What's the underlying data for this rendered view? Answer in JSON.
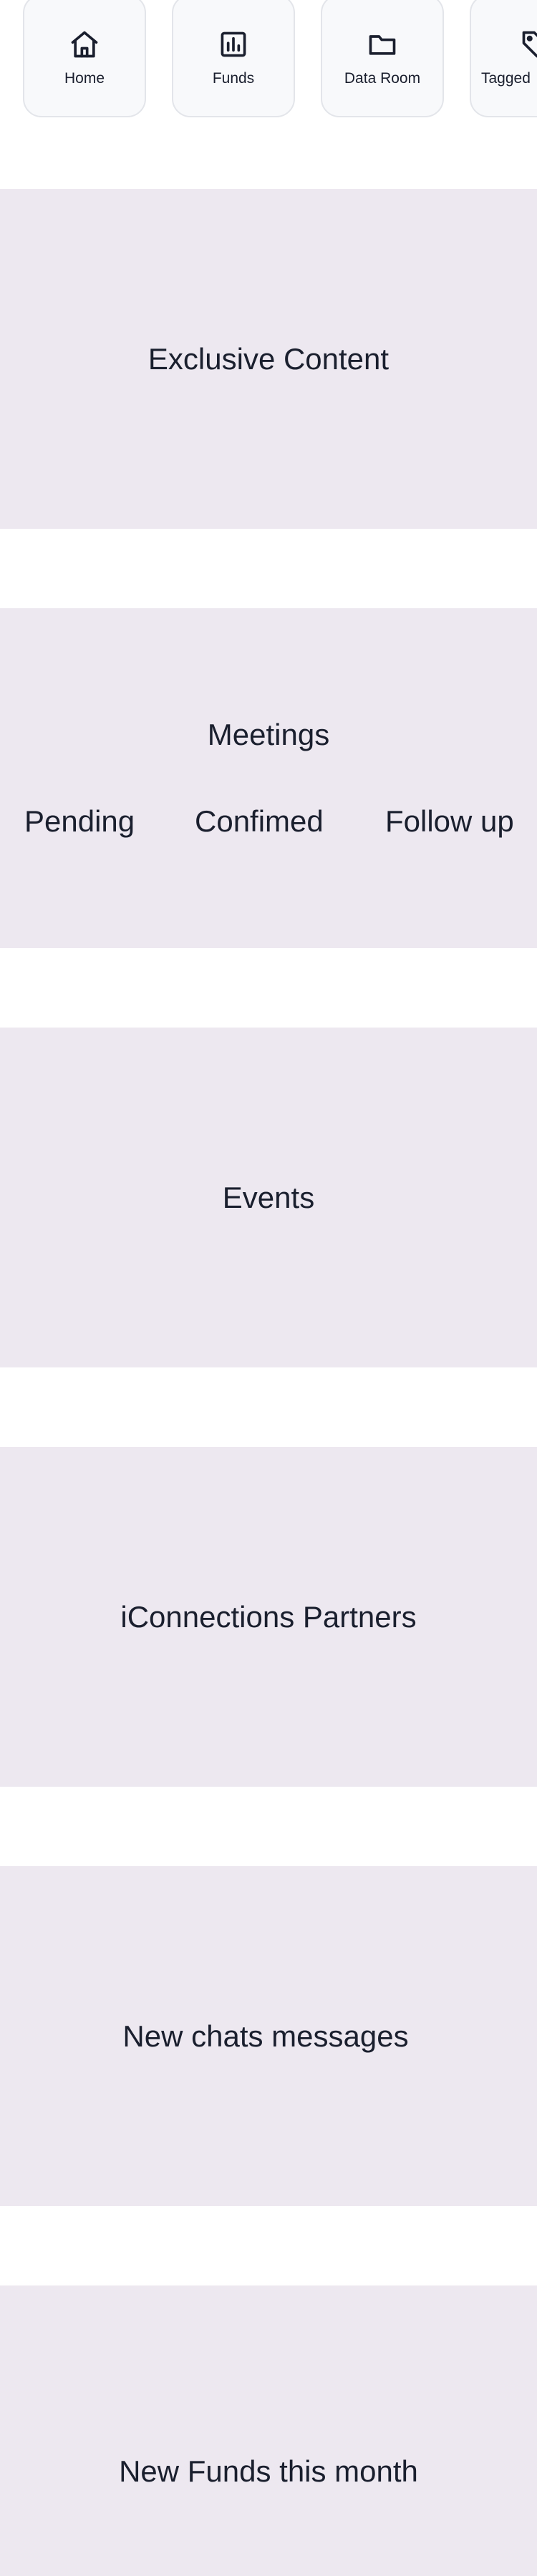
{
  "nav": {
    "items": [
      {
        "label": "Home",
        "icon": "home-icon"
      },
      {
        "label": "Funds",
        "icon": "bar-chart-icon"
      },
      {
        "label": "Data Room",
        "icon": "folder-icon"
      },
      {
        "label": "Tagged",
        "icon": "tag-icon"
      }
    ]
  },
  "sections": {
    "exclusive_content": {
      "title": "Exclusive Content"
    },
    "meetings": {
      "title": "Meetings",
      "statuses": [
        "Pending",
        "Confimed",
        "Follow up"
      ]
    },
    "events": {
      "title": "Events"
    },
    "partners": {
      "title": "iConnections Partners"
    },
    "chats": {
      "title": "New chats messages"
    },
    "new_funds": {
      "title": "New Funds this month"
    }
  },
  "colors": {
    "card_background": "#f8f9fb",
    "card_border": "#e3e5ea",
    "section_background": "#ede8f0",
    "text": "#1a1f2e"
  }
}
